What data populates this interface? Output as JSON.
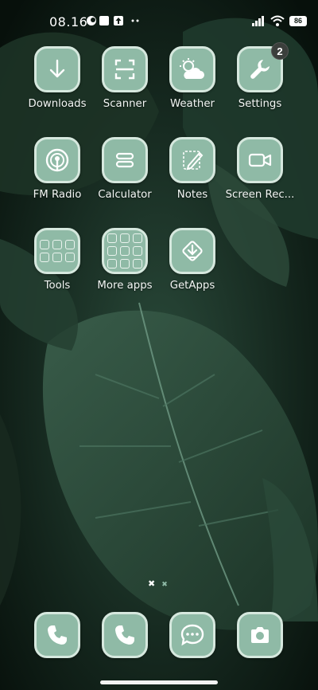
{
  "status_bar": {
    "time": "08.16",
    "battery": "86"
  },
  "apps": [
    {
      "label": "Downloads",
      "icon": "download-icon"
    },
    {
      "label": "Scanner",
      "icon": "scanner-icon"
    },
    {
      "label": "Weather",
      "icon": "weather-icon"
    },
    {
      "label": "Settings",
      "icon": "wrench-icon",
      "badge": "2"
    },
    {
      "label": "FM Radio",
      "icon": "radio-icon"
    },
    {
      "label": "Calculator",
      "icon": "calculator-icon"
    },
    {
      "label": "Notes",
      "icon": "notes-icon"
    },
    {
      "label": "Screen Rec...",
      "icon": "video-camera-icon"
    },
    {
      "label": "Tools",
      "icon": "folder-icon"
    },
    {
      "label": "More apps",
      "icon": "folder-icon"
    },
    {
      "label": "GetApps",
      "icon": "getapps-icon"
    }
  ],
  "dock": [
    {
      "icon": "phone-icon"
    },
    {
      "icon": "phone-icon"
    },
    {
      "icon": "message-icon"
    },
    {
      "icon": "camera-icon"
    }
  ],
  "pages": {
    "current": 1,
    "total": 2
  },
  "colors": {
    "tile": "#8fbaa6",
    "tile_border": "#d6e8de",
    "wallpaper": "#0e1a14"
  }
}
